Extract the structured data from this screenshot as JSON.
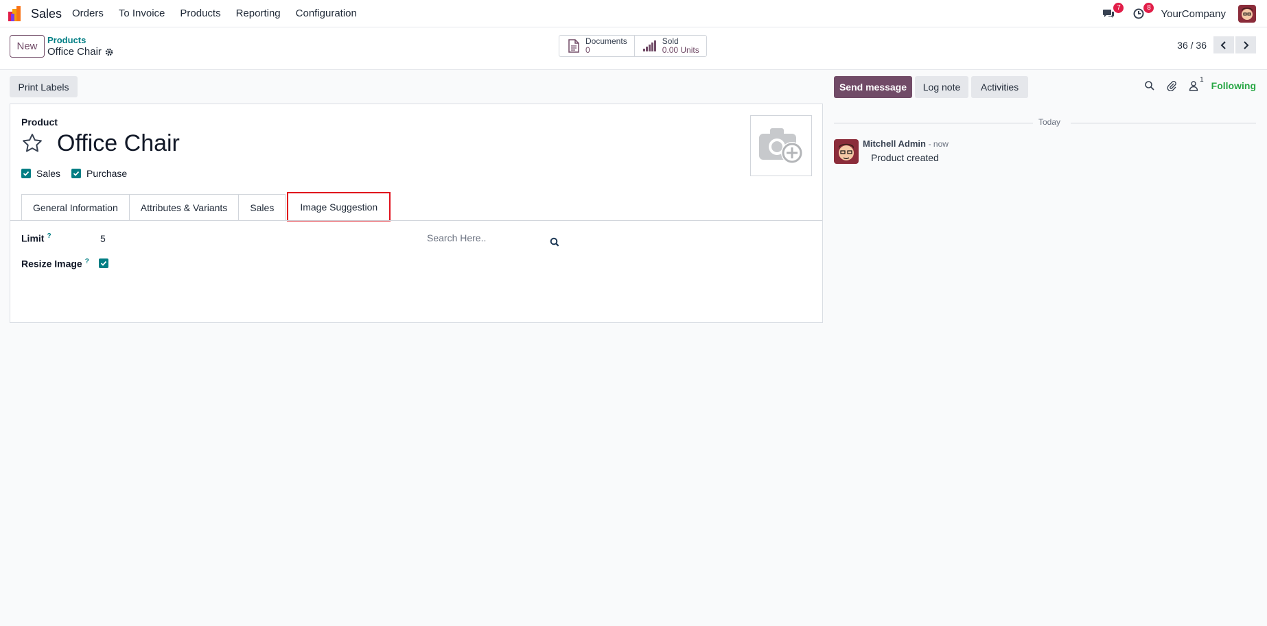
{
  "navbar": {
    "app_name": "Sales",
    "menu": [
      "Orders",
      "To Invoice",
      "Products",
      "Reporting",
      "Configuration"
    ],
    "messages_count": "7",
    "activities_count": "8",
    "company": "YourCompany"
  },
  "control": {
    "new_label": "New",
    "breadcrumb_parent": "Products",
    "breadcrumb_current": "Office Chair",
    "documents_label": "Documents",
    "documents_value": "0",
    "sold_label": "Sold",
    "sold_value": "0.00 Units",
    "pager": "36 / 36"
  },
  "form": {
    "print_labels": "Print Labels",
    "product_label": "Product",
    "product_name": "Office Chair",
    "sales_label": "Sales",
    "purchase_label": "Purchase",
    "tabs": [
      "General Information",
      "Attributes & Variants",
      "Sales",
      "Image Suggestion"
    ],
    "active_tab": "Image Suggestion",
    "limit_label": "Limit",
    "limit_value": "5",
    "resize_label": "Resize Image",
    "help_mark": "?",
    "search_placeholder": "Search Here.."
  },
  "chatter": {
    "send_message": "Send message",
    "log_note": "Log note",
    "activities": "Activities",
    "followers_count": "1",
    "following": "Following",
    "today": "Today",
    "author": "Mitchell Admin",
    "time": "- now",
    "body": "Product created"
  },
  "colors": {
    "brand": "#714b67",
    "teal": "#017e84",
    "highlight": "#e0101c",
    "following": "#28a745"
  }
}
